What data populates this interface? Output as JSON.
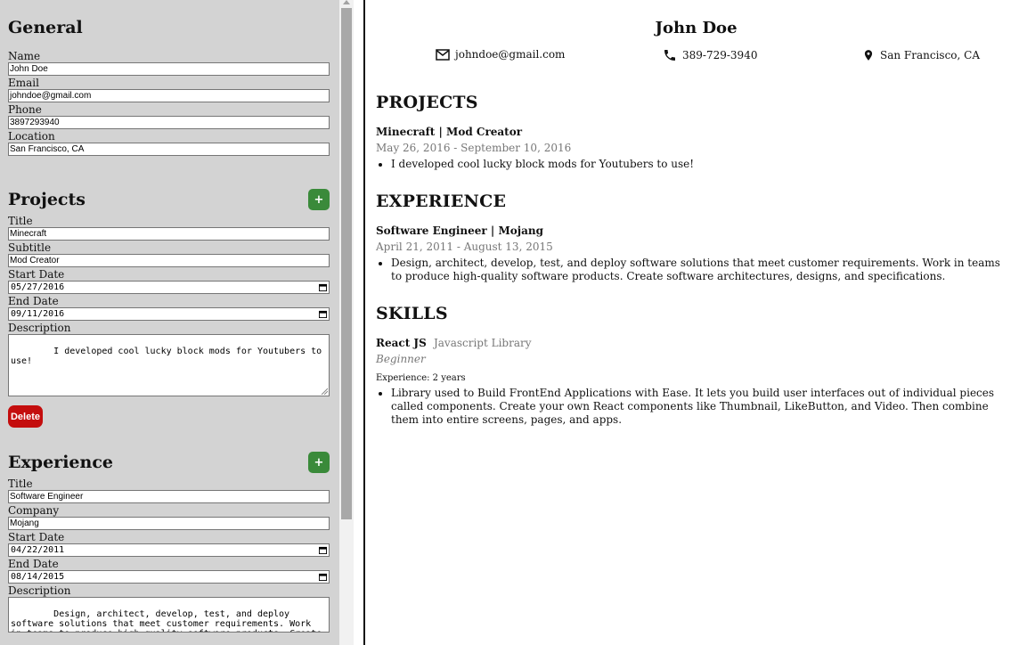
{
  "general": {
    "heading": "General",
    "name_label": "Name",
    "name_value": "John Doe",
    "email_label": "Email",
    "email_value": "johndoe@gmail.com",
    "phone_label": "Phone",
    "phone_value": "3897293940",
    "location_label": "Location",
    "location_value": "San Francisco, CA"
  },
  "projects_form": {
    "heading": "Projects",
    "add_label": "+",
    "title_label": "Title",
    "title_value": "Minecraft",
    "subtitle_label": "Subtitle",
    "subtitle_value": "Mod Creator",
    "start_label": "Start Date",
    "start_value": "05/27/2016",
    "end_label": "End Date",
    "end_value": "09/11/2016",
    "desc_label": "Description",
    "desc_value": "I developed cool lucky block mods for Youtubers to use!",
    "delete_label": "Delete"
  },
  "experience_form": {
    "heading": "Experience",
    "add_label": "+",
    "title_label": "Title",
    "title_value": "Software Engineer",
    "company_label": "Company",
    "company_value": "Mojang",
    "start_label": "Start Date",
    "start_value": "04/22/2011",
    "end_label": "End Date",
    "end_value": "08/14/2015",
    "desc_label": "Description",
    "desc_value": "Design, architect, develop, test, and deploy software solutions that meet customer requirements. Work in teams to produce high-quality software products. Create software"
  },
  "resume": {
    "name": "John Doe",
    "email": "johndoe@gmail.com",
    "phone": "389-729-3940",
    "location": "San Francisco, CA",
    "projects_heading": "PROJECTS",
    "project_title": "Minecraft | Mod Creator",
    "project_dates": "May 26, 2016 - September 10, 2016",
    "project_bullet": "I developed cool lucky block mods for Youtubers to use!",
    "experience_heading": "EXPERIENCE",
    "experience_title": "Software Engineer | Mojang",
    "experience_dates": "April 21, 2011 - August 13, 2015",
    "experience_bullet": "Design, architect, develop, test, and deploy software solutions that meet customer requirements. Work in teams to produce high-quality software products. Create software architectures, designs, and specifications.",
    "skills_heading": "SKILLS",
    "skill_name": "React JS",
    "skill_category": "Javascript Library",
    "skill_level": "Beginner",
    "skill_experience": "Experience: 2 years",
    "skill_bullet": "Library used to Build FrontEnd Applications with Ease. It lets you build user interfaces out of individual pieces called components. Create your own React components like Thumbnail, LikeButton, and Video. Then combine them into entire screens, pages, and apps."
  },
  "colors": {
    "panel_bg": "#d3d3d3",
    "add_button": "#3a8a3a",
    "delete_button": "#c40d0d",
    "muted_text": "#777777"
  },
  "icons": {
    "email": "mail-icon",
    "phone": "phone-icon",
    "location": "location-pin-icon",
    "date": "calendar-icon"
  }
}
